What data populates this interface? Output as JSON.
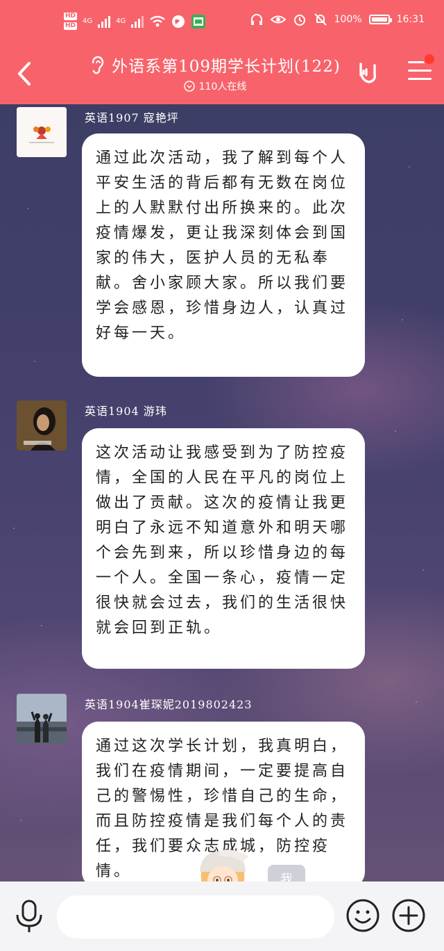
{
  "status_bar": {
    "hd1": "HD",
    "hd2": "HD",
    "net1": "4G",
    "net2": "4G",
    "battery": "100%",
    "time": "16:31"
  },
  "header": {
    "title": "外语系第109期学长计划(122)",
    "online": "110人在线",
    "colors": {
      "bar": "#f8636b"
    }
  },
  "messages": [
    {
      "sender": "英语1907 寇艳坪",
      "text": "通过此次活动，我了解到每个人平安生活的背后都有无数在岗位上的人默默付出所换来的。此次疫情爆发，更让我深刻体会到国家的伟大，医护人员的无私奉献。舍小家顾大家。所以我们要学会感恩，珍惜身边人，认真过好每一天。"
    },
    {
      "sender": "英语1904 游玮",
      "text": "这次活动让我感受到为了防控疫情，全国的人民在平凡的岗位上做出了贡献。这次的疫情让我更明白了永远不知道意外和明天哪个会先到来，所以珍惜身边的每一个人。全国一条心，疫情一定很快就会过去，我们的生活很快就会回到正轨。"
    },
    {
      "sender": "英语1904崔琛妮2019802423",
      "text": "通过这次学长计划，我真明白，我们在疫情期间，一定要提高自己的警惕性，珍惜自己的生命，而且防控疫情是我们每个人的责任，我们要众志成城，防控疫情。"
    }
  ],
  "overlay": {
    "me_label": "我"
  },
  "input_bar": {
    "placeholder": ""
  }
}
